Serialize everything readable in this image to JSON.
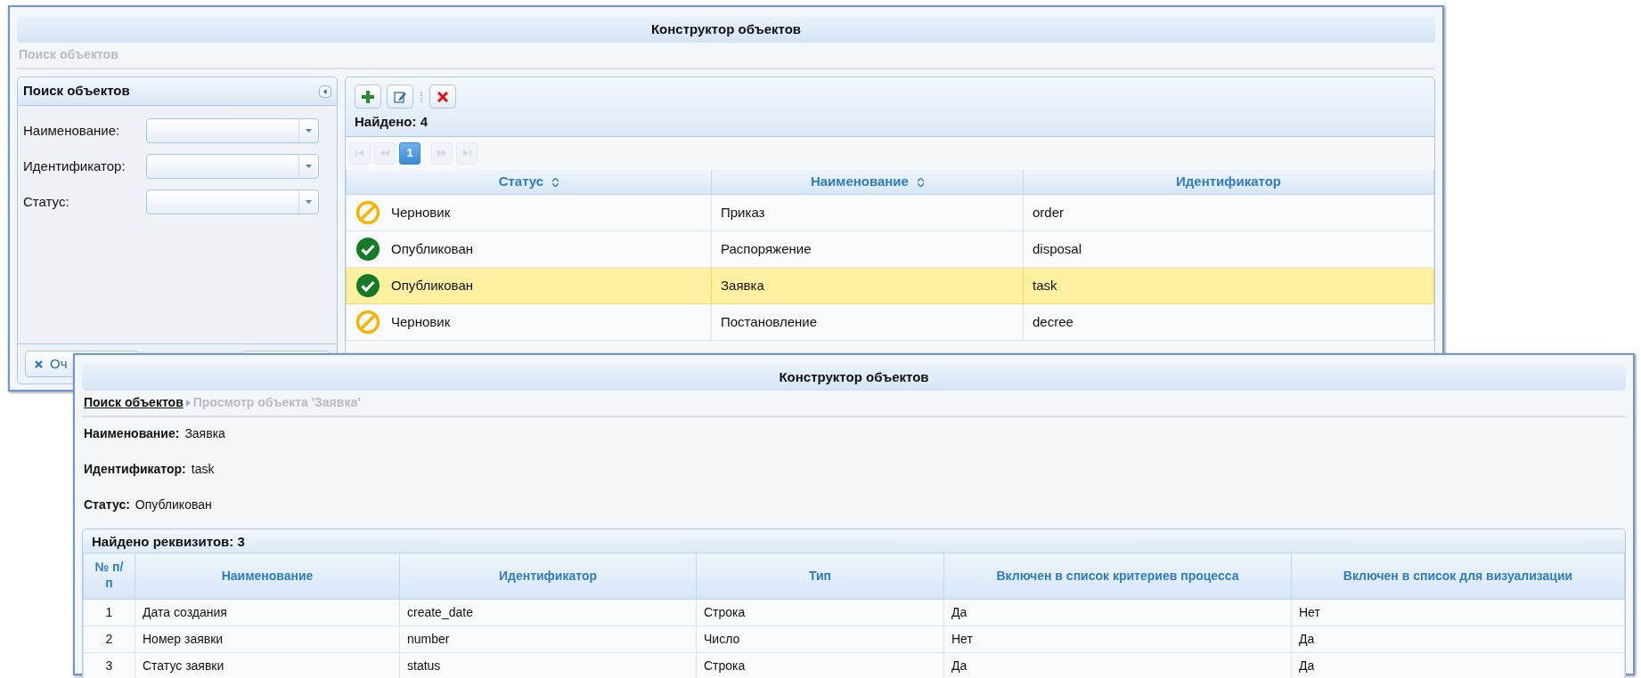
{
  "search_window": {
    "title": "Конструктор объектов",
    "breadcrumb": [
      {
        "label": "Поиск объектов",
        "link": false
      }
    ],
    "filter_panel": {
      "title": "Поиск объектов",
      "fields": [
        {
          "label": "Наименование:"
        },
        {
          "label": "Идентификатор:"
        },
        {
          "label": "Статус:"
        }
      ],
      "buttons": [
        {
          "kind": "clear",
          "label": "Оч"
        },
        {
          "kind": "blank"
        }
      ]
    },
    "toolbar": [
      {
        "kind": "add"
      },
      {
        "kind": "edit"
      },
      {
        "kind": "separator"
      },
      {
        "kind": "delete"
      }
    ],
    "found": "Найдено: 4",
    "pager": [
      {
        "kind": "first",
        "disabled": true
      },
      {
        "kind": "prev",
        "disabled": true
      },
      {
        "kind": "page",
        "label": "1",
        "selected": true
      },
      {
        "kind": "next",
        "disabled": true
      },
      {
        "kind": "last",
        "disabled": true
      }
    ],
    "grid": {
      "columns": [
        {
          "label": "Статус",
          "sortable": true
        },
        {
          "label": "Наименование",
          "sortable": true
        },
        {
          "label": "Идентификатор",
          "sortable": false
        }
      ],
      "rows": [
        {
          "status": {
            "kind": "draft",
            "label": "Черновик"
          },
          "name": "Приказ",
          "id": "order",
          "selected": false
        },
        {
          "status": {
            "kind": "published",
            "label": "Опубликован"
          },
          "name": "Распоряжение",
          "id": "disposal",
          "selected": false
        },
        {
          "status": {
            "kind": "published",
            "label": "Опубликован"
          },
          "name": "Заявка",
          "id": "task",
          "selected": true
        },
        {
          "status": {
            "kind": "draft",
            "label": "Черновик"
          },
          "name": "Постановление",
          "id": "decree",
          "selected": false
        }
      ]
    }
  },
  "view_window": {
    "title": "Конструктор объектов",
    "breadcrumb": [
      {
        "label": "Поиск объектов",
        "link": true
      },
      {
        "label": "Просмотр объекта 'Заявка'",
        "link": false
      }
    ],
    "fields": [
      {
        "label": "Наименование:",
        "value": "Заявка"
      },
      {
        "label": "Идентификатор:",
        "value": "task"
      },
      {
        "label": "Статус:",
        "value": "Опубликован"
      }
    ],
    "attributes": {
      "title": "Найдено реквизитов: 3",
      "columns": [
        "№ п/п",
        "Наименование",
        "Идентификатор",
        "Тип",
        "Включен в список критериев процесса",
        "Включен в список для визуализации"
      ],
      "rows": [
        [
          "1",
          "Дата создания",
          "create_date",
          "Строка",
          "Да",
          "Нет"
        ],
        [
          "2",
          "Номер заявки",
          "number",
          "Число",
          "Нет",
          "Да"
        ],
        [
          "3",
          "Статус заявки",
          "status",
          "Строка",
          "Да",
          "Да"
        ]
      ]
    }
  }
}
